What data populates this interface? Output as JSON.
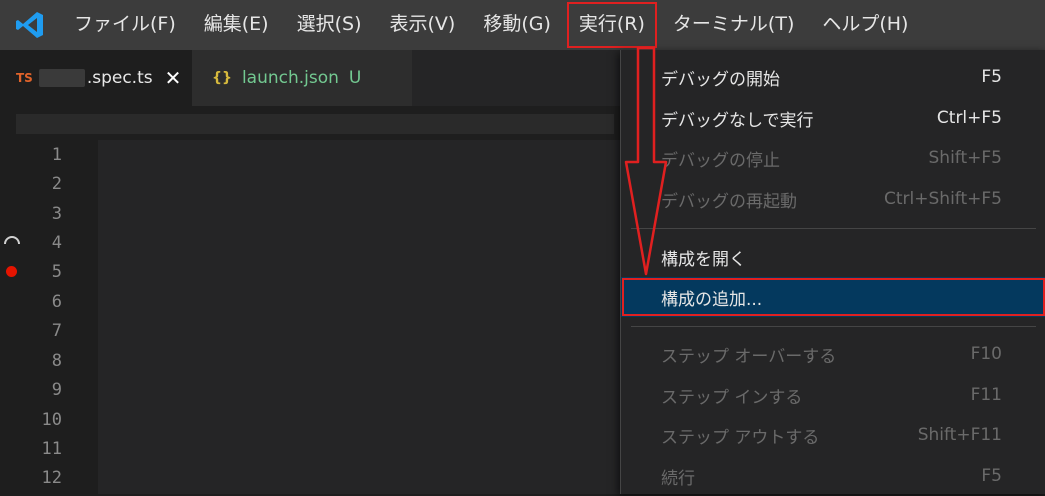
{
  "menubar": {
    "items": [
      "ファイル(F)",
      "編集(E)",
      "選択(S)",
      "表示(V)",
      "移動(G)",
      "実行(R)",
      "ターミナル(T)",
      "ヘルプ(H)"
    ]
  },
  "tabs": {
    "spec": {
      "icon": "TS",
      "name": ".spec.ts",
      "close": "✕"
    },
    "launch": {
      "icon": "{}",
      "name": "launch.json",
      "badge": "U"
    }
  },
  "editor": {
    "line_numbers": [
      "1",
      "2",
      "3",
      "4",
      "5",
      "6",
      "7",
      "8",
      "9",
      "10",
      "11",
      "12"
    ]
  },
  "run_menu": {
    "items": [
      {
        "label": "デバッグの開始",
        "key": "F5"
      },
      {
        "label": "デバッグなしで実行",
        "key": "Ctrl+F5"
      },
      {
        "label": "デバッグの停止",
        "key": "Shift+F5"
      },
      {
        "label": "デバッグの再起動",
        "key": "Ctrl+Shift+F5"
      },
      {
        "label": "構成を開く",
        "key": ""
      },
      {
        "label": "構成の追加...",
        "key": ""
      },
      {
        "label": "ステップ オーバーする",
        "key": "F10"
      },
      {
        "label": "ステップ インする",
        "key": "F11"
      },
      {
        "label": "ステップ アウトする",
        "key": "Shift+F11"
      },
      {
        "label": "続行",
        "key": "F5"
      }
    ]
  },
  "colors": {
    "menubar_bg": "#3c3c3c",
    "selected_item_bg": "#04395e",
    "annotation_red": "#e02020",
    "breakpoint_red": "#e51400"
  }
}
